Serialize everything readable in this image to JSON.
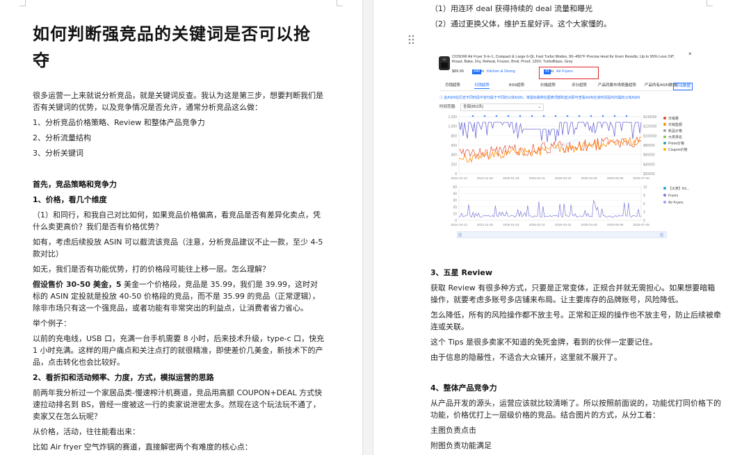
{
  "left": {
    "title": "如何判断强竞品的关键词是否可以抢夺",
    "intro": "很多运营一上来就说分析竞品，就是关键词反查。我认为这是第三步，想要判断我们是否有关键词的优势，以及竞争情况是否允许，通常分析竞品这么做：",
    "list": [
      "1、分析竞品价格策略、Review 和整体产品竞争力",
      "2、分析流量结构",
      "3、分析关键词"
    ],
    "h_first": "首先，竞品策略和竞争力",
    "h_price": "1、价格，看几个维度",
    "p1": "（1）和同行，和我自己对比如何，如果竞品价格偏高，看竞品是否有差异化卖点，凭什么卖更高价？我们是否有价格优势？",
    "p2": "如有，考虑后续投放 ASIN 可以截流该竞品（注意，分析竞品建议不止一款，至少 4-5 款对比）",
    "p3": "如无，我们是否有功能优势，打的价格段可能往上移一层。怎么理解？",
    "p4_bold": "假设售价 30-50 美金，5",
    "p4_rest": " 美金一个价格段，竞品是 35.99，我们是 39.99，这时对标的 ASIN 定投就是投放 40-50 价格段的竞品，而不是 35.99 的竞品（正常逻辑），除非市场只有这一个强竞品，或者功能有非常突出的利益点，让消费者省力省心。",
    "p5": "举个例子：",
    "p6": "以前的充电线，USB 口，充满一台手机需要 8 小时，后来技术升级，type-c 口，快充 1 小时充满。这样的用户痛点和关注点打的就很精准，即使差价几美金，新技术下的产品，点击转化也会比较好。",
    "h_deal": "2、看折扣和活动频率、力度，方式，模拟运营的思路",
    "p7": "前两年我分析过一个家居品类-慢速榨汁机赛道，竞品用高额 COUPON+DEAL 方式快速拉动排名到 BS，曾经一度被这一行的卖家说泄密太多。然现在这个玩法玩不通了，卖家又在怎么玩呢？",
    "p8": "从价格，活动，往往能看出来：",
    "p9": "比如 Air fryer 空气炸锅的赛道，直接解密两个有难度的核心点："
  },
  "right": {
    "l1": "（1）用连环 deal 获得持续的 deal 流量和曝光",
    "l2": "（2）通过更换父体，维护五星好评。这个大家懂的。",
    "embed": {
      "product": "COSORI Air Fryer 9-in-1, Compact & Large 6-Qt, Fast Turbo Modes, 90–450°F Precise Heat for Even Results, Up to 95% Less Oil*, Roast, Bake, Dry, Reheat, Frozen, Broil, Proof, 120V, TurboBlaze, Grey",
      "price": "$89.99",
      "rank1": "#40",
      "in": "in",
      "cat1": "Kitchen & Dining",
      "rank2": "#1",
      "cat2": "Air Fryers",
      "close": "×",
      "tabs": [
        "月销趋势",
        "日销趋势",
        "BSR趋势",
        "价格趋势",
        "评分趋势",
        "产品同属市场销量趋势",
        "产品所有ASIN数据"
      ],
      "export": "导出数据",
      "notice": "ⓘ 此ASIN在历史不同时段中曾归属于不同的父体ASIN，将鼠标悬停在图表顶部的蓝点即可查看ASIN在该时间段内归属的父体ASIN",
      "range_label": "时间范围:",
      "range_value": "全部(853天)",
      "y_left": [
        "1,200",
        "1,000",
        "800",
        "600",
        "400",
        "200",
        "0"
      ],
      "y_right": [
        "$140000",
        "$120000",
        "$100000",
        "$80000",
        "$60000",
        "$40000",
        "$20000"
      ],
      "x_dates": [
        "2024-10-13",
        "2024-11-25",
        "2025-01-03",
        "2025-02-11",
        "2025-03-22",
        "2025-04-30",
        "2025-06-08",
        "2025-07-08"
      ],
      "legend1": [
        "日销量",
        "日销售额",
        "新品价格",
        "大类排名",
        "Prime价格",
        "Coupon价格"
      ],
      "y2_left": [
        "50",
        "40",
        "30",
        "20",
        "10",
        "0"
      ],
      "y2_right": [
        "12",
        "9",
        "6",
        "3",
        "0"
      ],
      "legend2": [
        "【大类】Kit...",
        "Fryers",
        "Air Fryers"
      ],
      "watermark": "Sorftime"
    },
    "h3": "3、五星 Review",
    "p1": "获取 Review 有很多种方式，只要是正常变体，正规合并就无需担心。如果想要暗箱操作，就要考虑多账号多店铺来布局。让主要库存的品牌账号，风险降低。",
    "p2": "怎么降低，所有的风险操作都不放主号。正常和正规的操作也不放主号，防止后续被牵连或关联。",
    "p3": "这个 Tips 是很多卖家不知道的免死金牌，看到的伙伴一定要记住。",
    "p4": "由于信息的隐蔽性，不适合大众铺开，这里就不展开了。",
    "h4": "4、整体产品竞争力",
    "p5": "从产品开发的源头，运营应该就比较清晰了。所以按照前面说的，功能优打同价格下的功能，价格优打上一层级价格的竞品。结合图片的方式，从分工着：",
    "p6": "主图负责点击",
    "p7": "附图负责功能满足"
  },
  "colors": {
    "accent": "#1e6fff",
    "orange": "#ff8a00",
    "purple": "#6b6bd6",
    "red_box": "#e02020"
  }
}
